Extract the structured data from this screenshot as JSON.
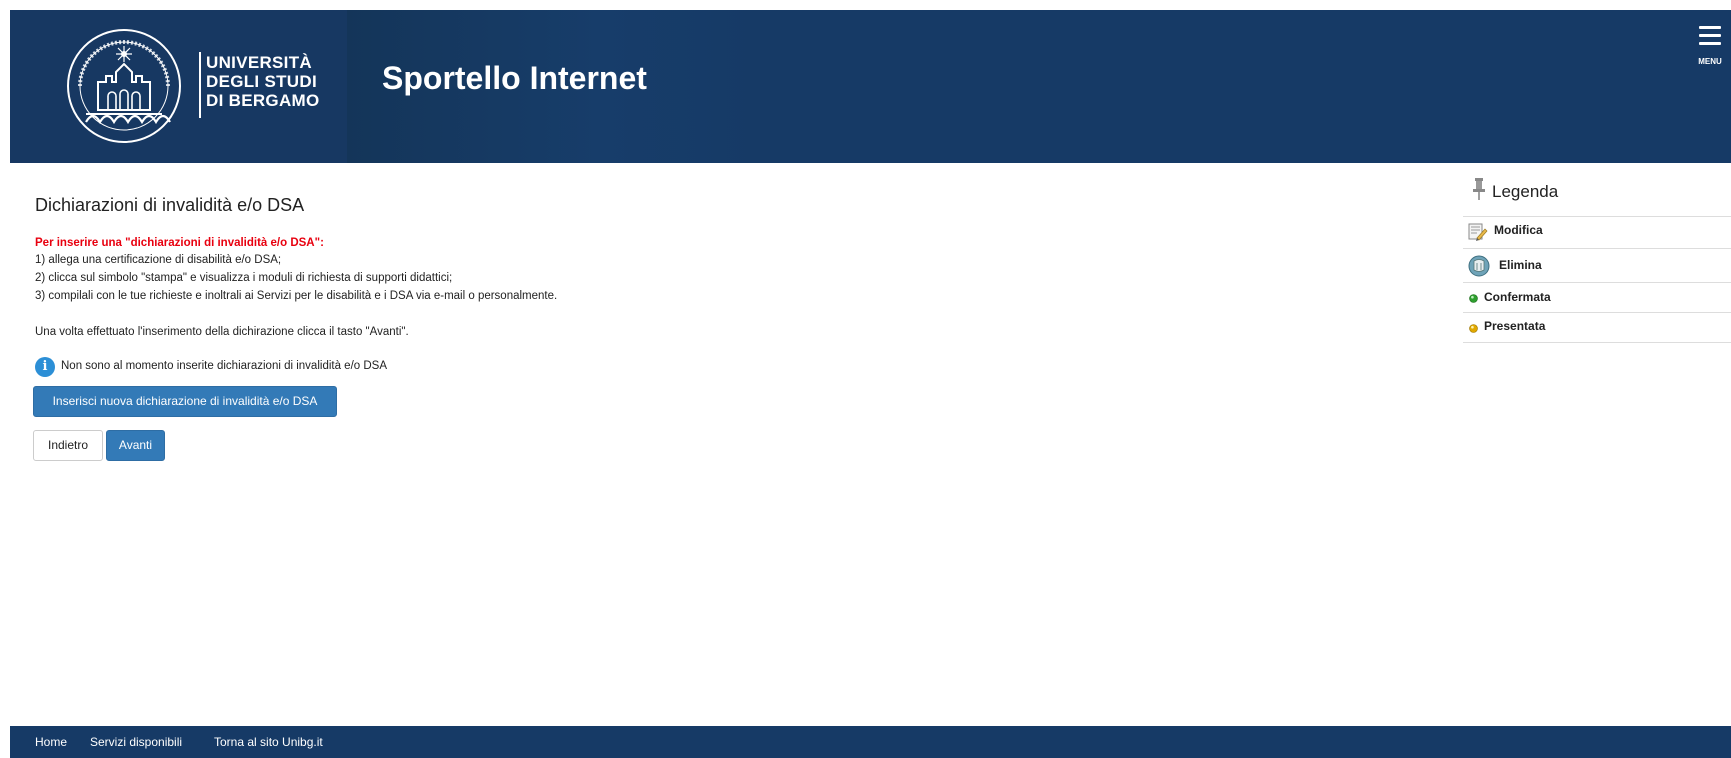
{
  "header": {
    "university_lines": [
      "UNIVERSITÀ",
      "DEGLI STUDI",
      "DI BERGAMO"
    ],
    "app_title": "Sportello Internet",
    "menu_label": "MENU",
    "colors": {
      "header_bg": "#163a66",
      "accent": "#337ab7"
    }
  },
  "main": {
    "page_title": "Dichiarazioni di invalidità e/o DSA",
    "instructions_heading": "Per inserire una \"dichiarazioni di invalidità e/o DSA\":",
    "instructions": [
      "1) allega una certificazione di disabilità e/o DSA;",
      "2) clicca sul simbolo \"stampa\" e visualizza i moduli di richiesta di supporti didattici;",
      "3) compilali con le tue richieste e inoltrali ai Servizi per le disabilità e i DSA via e-mail o personalmente."
    ],
    "note": "Una volta effettuato l'inserimento della dichirazione clicca il tasto \"Avanti\".",
    "info_message": "Non sono al momento inserite dichiarazioni di invalidità e/o DSA",
    "insert_button": "Inserisci nuova dichiarazione di invalidità e/o DSA",
    "back_button": "Indietro",
    "next_button": "Avanti"
  },
  "legend": {
    "title": "Legenda",
    "items": [
      {
        "label": "Modifica",
        "icon": "edit-icon"
      },
      {
        "label": "Elimina",
        "icon": "delete-icon"
      },
      {
        "label": "Confermata",
        "icon": "green-dot-icon",
        "color": "#2e9e2e"
      },
      {
        "label": "Presentata",
        "icon": "yellow-dot-icon",
        "color": "#e0a800"
      }
    ]
  },
  "footer": {
    "links": [
      "Home",
      "Servizi disponibili",
      "Torna al sito Unibg.it"
    ]
  }
}
